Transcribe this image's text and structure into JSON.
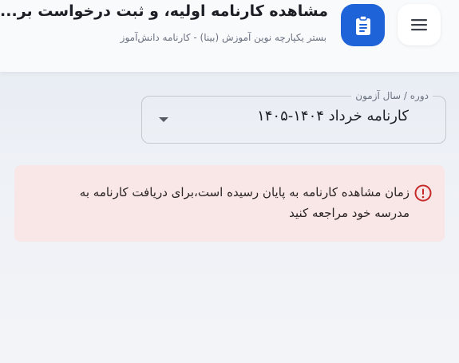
{
  "header": {
    "title": "مشاهده کارنامه اولیه، و ثبت درخواست بر...",
    "subtitle": "بستر یکپارچه نوین آموزش (بینا) - کارنامه دانش‌آموز",
    "menu_icon": "hamburger-menu-icon",
    "app_icon": "clipboard-icon",
    "accent_color": "#1f63d8"
  },
  "period_select": {
    "label": "دوره / سال آزمون",
    "value": "کارنامه خرداد ۱۴۰۴-۱۴۰۵",
    "arrow_icon": "caret-down-icon"
  },
  "alert": {
    "icon": "error-circle-icon",
    "message": "زمان مشاهده کارنامه به پایان رسیده است،برای دریافت کارنامه به مدرسه خود مراجعه کنید",
    "background_color": "#f9e6e6",
    "icon_color": "#c62828"
  }
}
